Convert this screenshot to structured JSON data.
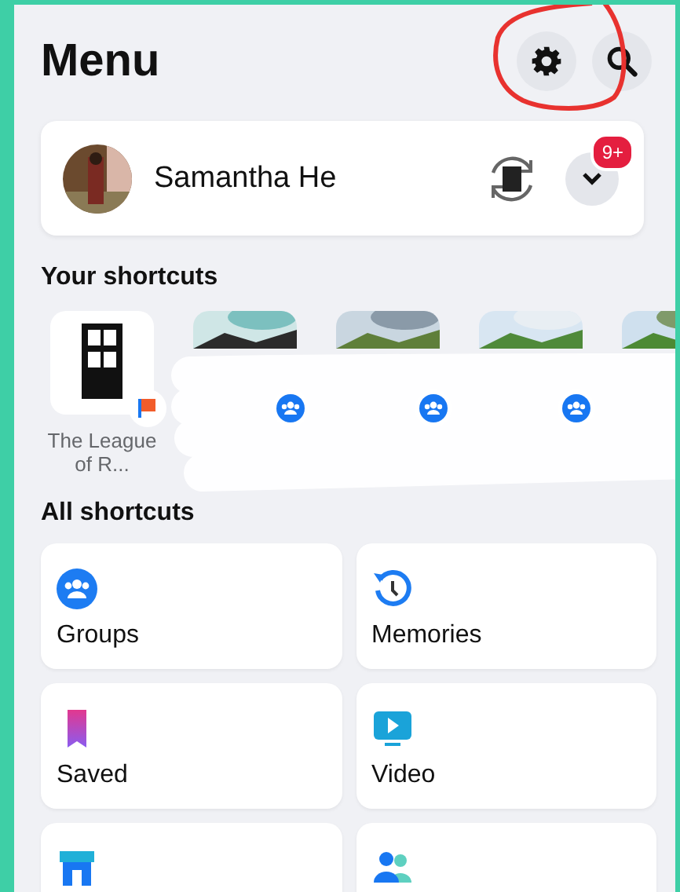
{
  "header": {
    "title": "Menu"
  },
  "profile": {
    "name": "Samantha He",
    "notification_badge": "9+"
  },
  "your_shortcuts": {
    "title": "Your shortcuts",
    "items": [
      {
        "label": "The League of R...",
        "kind": "page"
      },
      {
        "kind": "group"
      },
      {
        "kind": "group"
      },
      {
        "kind": "group"
      },
      {
        "kind": "picture"
      }
    ]
  },
  "all_shortcuts": {
    "title": "All shortcuts",
    "items": [
      {
        "label": "Groups",
        "kind": "groups"
      },
      {
        "label": "Memories",
        "kind": "memories"
      },
      {
        "label": "Saved",
        "kind": "saved"
      },
      {
        "label": "Video",
        "kind": "video"
      },
      {
        "kind": "marketplace"
      },
      {
        "kind": "friends"
      }
    ]
  }
}
